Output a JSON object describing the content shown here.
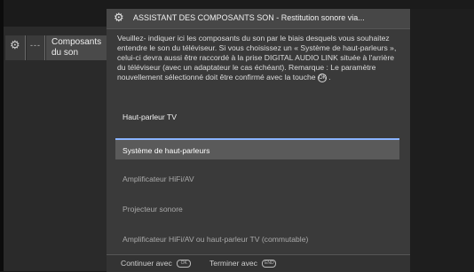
{
  "sidebar": {
    "icon": "gear-icon",
    "dash_label": "---",
    "active_label_line1": "Composants",
    "active_label_line2": "du son"
  },
  "dialog": {
    "title_icon": "gears-icon",
    "title": "ASSISTANT DES COMPOSANTS SON - Restitution sonore via...",
    "description_part1": "Veuillez- indiquer ici les composants du son par le biais desquels vous souhaitez entendre le son du téléviseur. Si vous choisissez un « Système de haut-parleurs », celui-ci devra aussi être raccordé à la prise DIGITAL AUDIO LINK située à l'arrière du téléviseur (avec un adaptateur le cas échéant). Remarque : Le paramètre nouvellement sélectionné doit être confirmé avec la touche",
    "ok_key_glyph": "OK",
    "description_part2": ".",
    "options": [
      {
        "label": "Haut-parleur TV",
        "state": "current"
      },
      {
        "label": "Système de haut-parleurs",
        "state": "selected"
      },
      {
        "label": "Amplificateur HiFi/AV",
        "state": "normal"
      },
      {
        "label": "Projecteur sonore",
        "state": "normal"
      },
      {
        "label": "Amplificateur HiFi/AV ou haut-parleur TV (commutable)",
        "state": "normal"
      }
    ],
    "hints": {
      "continue": "Continuer avec",
      "continue_key": "OK",
      "finish": "Terminer avec",
      "finish_key": "END"
    }
  }
}
